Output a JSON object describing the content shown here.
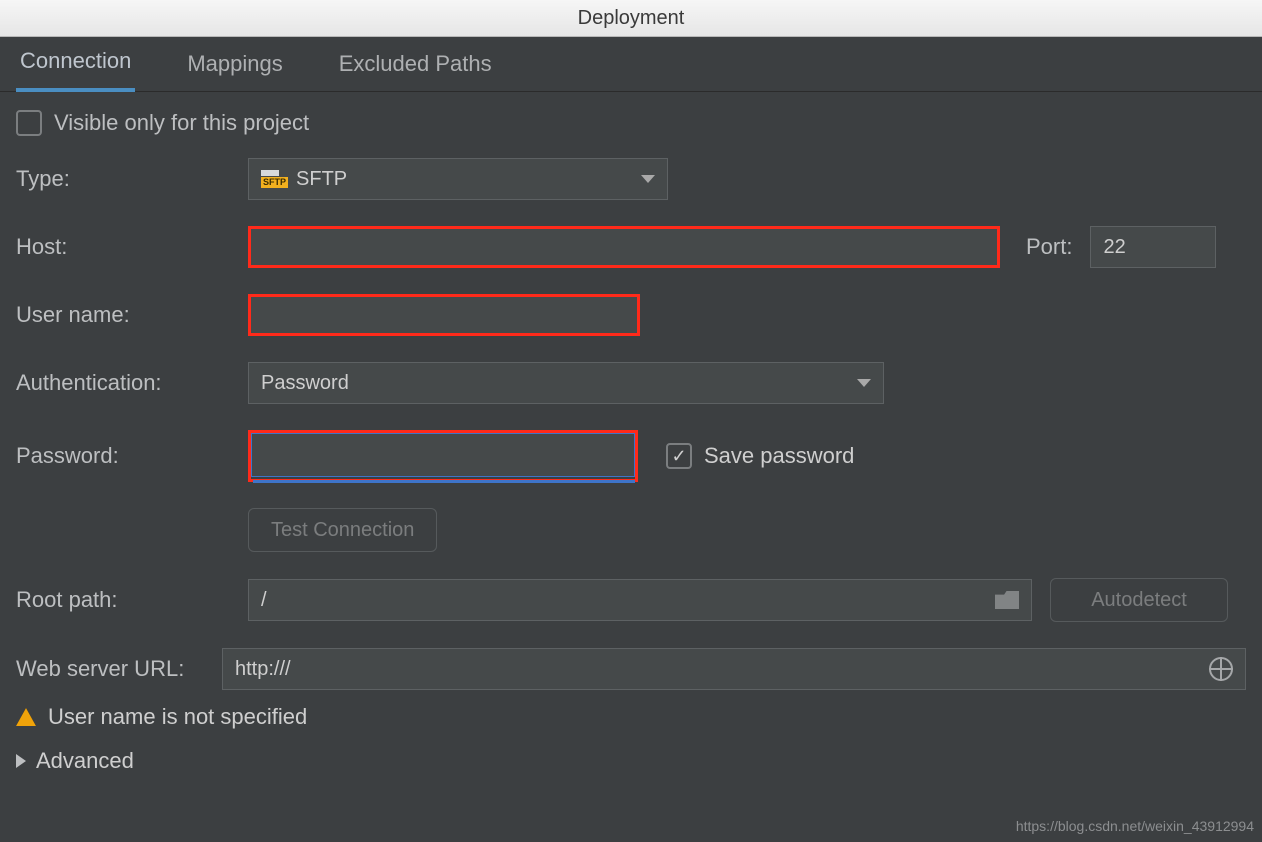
{
  "window": {
    "title": "Deployment"
  },
  "tabs": {
    "connection": "Connection",
    "mappings": "Mappings",
    "excluded": "Excluded Paths",
    "active": "connection"
  },
  "form": {
    "visible_only_label": "Visible only for this project",
    "visible_only_checked": false,
    "type_label": "Type:",
    "type_value": "SFTP",
    "host_label": "Host:",
    "host_value": "",
    "port_label": "Port:",
    "port_value": "22",
    "user_label": "User name:",
    "user_value": "",
    "auth_label": "Authentication:",
    "auth_value": "Password",
    "password_label": "Password:",
    "password_value": "",
    "save_password_label": "Save password",
    "save_password_checked": true,
    "test_connection_label": "Test Connection",
    "root_label": "Root path:",
    "root_value": "/",
    "autodetect_label": "Autodetect",
    "webserver_label": "Web server URL:",
    "webserver_value": "http:///",
    "warning_text": "User name is not specified",
    "advanced_label": "Advanced"
  },
  "watermark": "https://blog.csdn.net/weixin_43912994"
}
